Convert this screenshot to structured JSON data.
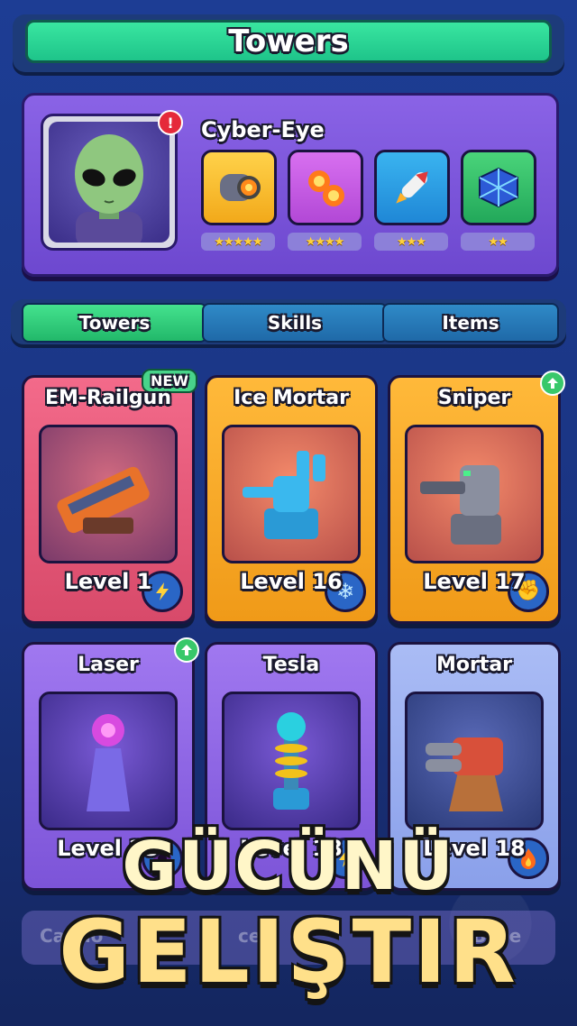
{
  "header": {
    "title": "Towers"
  },
  "hero": {
    "name": "Cyber-Eye",
    "alert": "!",
    "skills": [
      {
        "icon": "cannon-turret-icon",
        "stars": "★★★★★"
      },
      {
        "icon": "fireballs-icon",
        "stars": "★★★★"
      },
      {
        "icon": "rocket-icon",
        "stars": "★★★"
      },
      {
        "icon": "blue-crate-icon",
        "stars": "★★"
      }
    ]
  },
  "tabs": [
    "Towers",
    "Skills",
    "Items"
  ],
  "cards": [
    {
      "name": "EM-Railgun",
      "level": "Level 1",
      "tag": "NEW",
      "badge": "lightning-icon",
      "color": "red"
    },
    {
      "name": "Ice Mortar",
      "level": "Level 16",
      "badge": "snowflake-icon",
      "color": "orange"
    },
    {
      "name": "Sniper",
      "level": "Level 17",
      "badge": "fist-icon",
      "color": "orange",
      "upgrade": true
    },
    {
      "name": "Laser",
      "level": "Level 23",
      "badge": "vortex-icon",
      "color": "purple",
      "upgrade": true
    },
    {
      "name": "Tesla",
      "level": "Level 18",
      "badge": "lightning-icon",
      "color": "purple"
    },
    {
      "name": "Mortar",
      "level": "Level 18",
      "badge": "flame-icon",
      "color": "lavender"
    }
  ],
  "row3": {
    "left": "Canno",
    "middle": "ce",
    "right": "Base"
  },
  "promo": {
    "line1": "GÜCÜNÜ",
    "line2": "GELIŞTIR"
  },
  "colors": {
    "accent_green": "#22b86a",
    "panel_purple": "#7c54d8",
    "bg_blue": "#1d3d94"
  }
}
